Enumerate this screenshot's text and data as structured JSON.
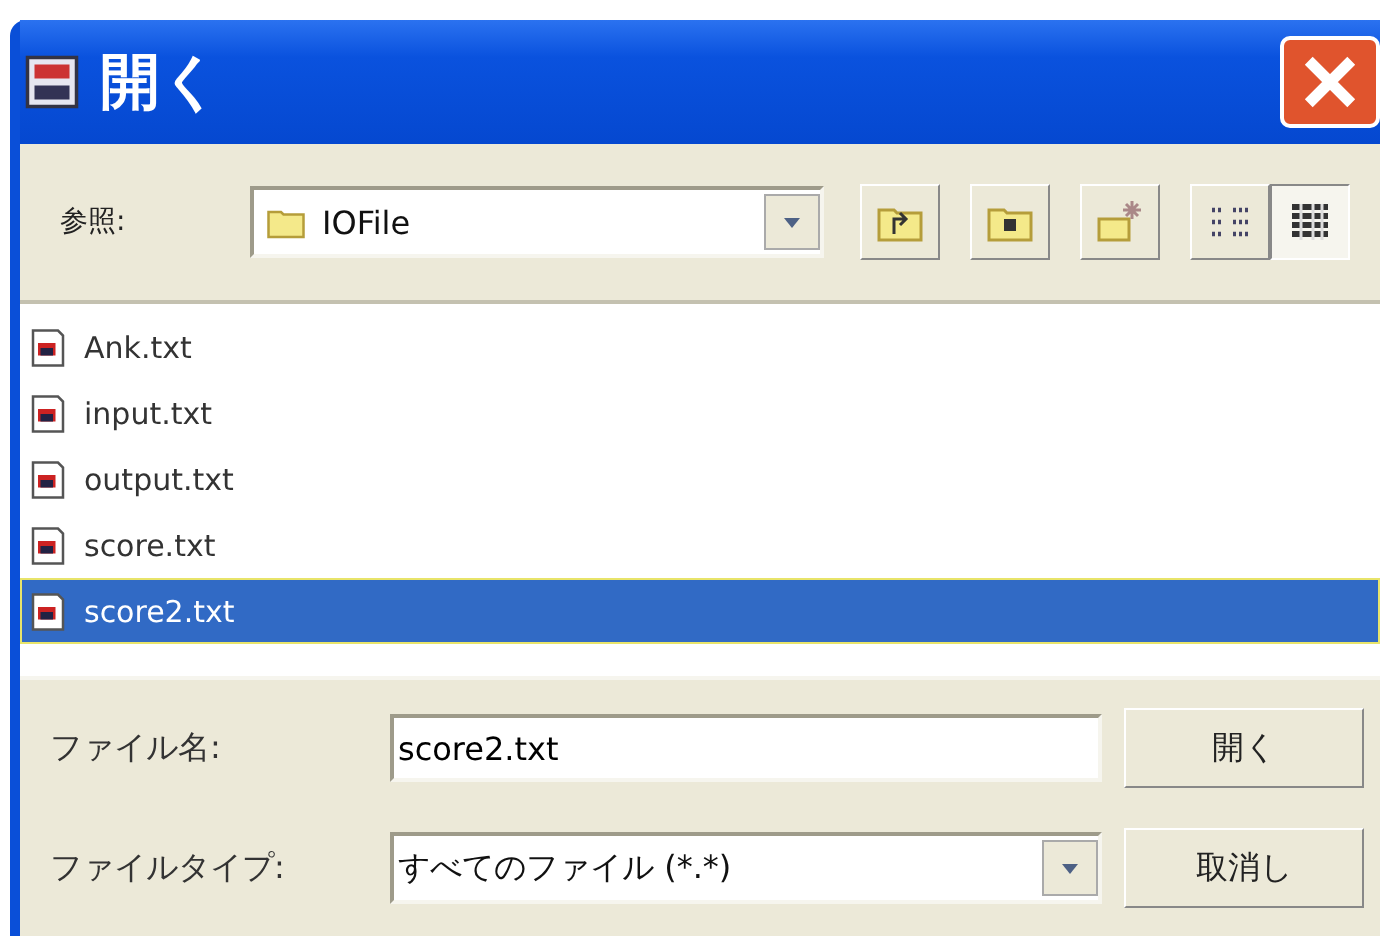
{
  "window": {
    "title": "開く"
  },
  "look_in": {
    "label": "参照:",
    "value": "IOFile"
  },
  "views": [
    {
      "kind": "list",
      "selected": false
    },
    {
      "kind": "details",
      "selected": true
    }
  ],
  "files": [
    {
      "name": "Ank.txt",
      "selected": false
    },
    {
      "name": "input.txt",
      "selected": false
    },
    {
      "name": "output.txt",
      "selected": false
    },
    {
      "name": "score.txt",
      "selected": false
    },
    {
      "name": "score2.txt",
      "selected": true
    }
  ],
  "file_name": {
    "label": "ファイル名:",
    "value": "score2.txt"
  },
  "file_type": {
    "label": "ファイルタイプ:",
    "value": "すべてのファイル (*.*)"
  },
  "buttons": [
    "開く",
    "取消し"
  ]
}
